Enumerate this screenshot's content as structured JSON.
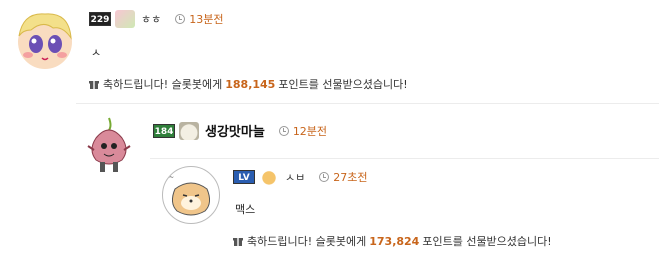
{
  "comments": [
    {
      "level": "229",
      "nickname": "ㅎㅎ",
      "time": "13분전",
      "text": "ㅅ",
      "gift": {
        "prefix": "축하드립니다! 슬롯봇에게",
        "points": "188,145",
        "suffix": "포인트를 선물받으셨습니다!"
      }
    },
    {
      "level": "184",
      "nickname": "생강맛마늘",
      "time": "12분전"
    },
    {
      "level": "LV",
      "nickname": "ㅅㅂ",
      "time": "27초전",
      "text": "맥스",
      "gift": {
        "prefix": "축하드립니다! 슬롯봇에게",
        "points": "173,824",
        "suffix": "포인트를 선물받으셨습니다!"
      }
    }
  ],
  "colors": {
    "accent": "#c8651b",
    "time_gray": "#888888"
  }
}
